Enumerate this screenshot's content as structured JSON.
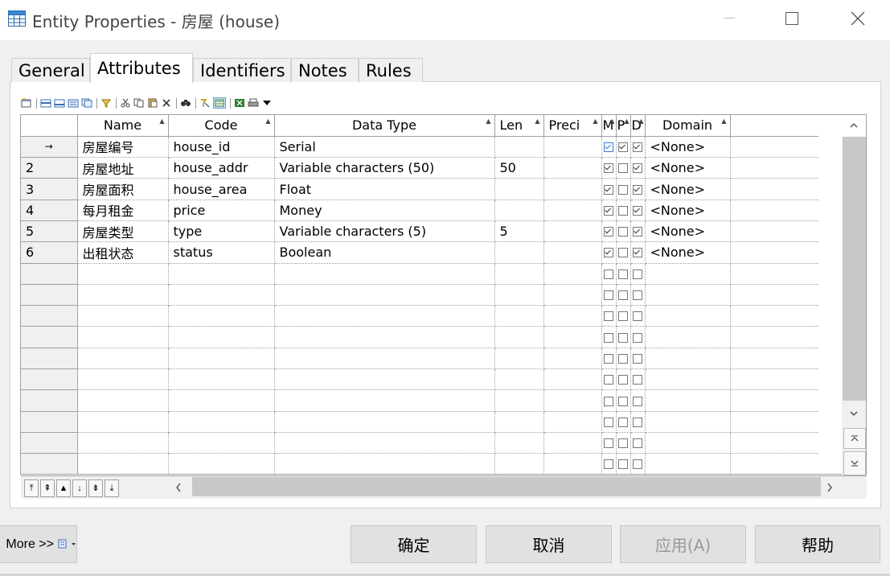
{
  "window": {
    "title": "Entity Properties - 房屋 (house)",
    "controls": {
      "minimize": "—",
      "maximize": "☐",
      "close": "✕"
    }
  },
  "tabs": [
    {
      "label": "General",
      "active": false
    },
    {
      "label": "Attributes",
      "active": true
    },
    {
      "label": "Identifiers",
      "active": false
    },
    {
      "label": "Notes",
      "active": false
    },
    {
      "label": "Rules",
      "active": false
    }
  ],
  "grid": {
    "columns": [
      "Name",
      "Code",
      "Data Type",
      "Len",
      "Preci",
      "M",
      "P",
      "D",
      "Domain"
    ],
    "current_row_marker": "→",
    "rows": [
      {
        "num": "",
        "name": "房屋编号",
        "code": "house_id",
        "type": "Serial",
        "len": "",
        "preci": "",
        "m": true,
        "p": true,
        "d": true,
        "domain": "<None>"
      },
      {
        "num": "2",
        "name": "房屋地址",
        "code": "house_addr",
        "type": "Variable characters (50)",
        "len": "50",
        "preci": "",
        "m": true,
        "p": false,
        "d": true,
        "domain": "<None>"
      },
      {
        "num": "3",
        "name": "房屋面积",
        "code": "house_area",
        "type": "Float",
        "len": "",
        "preci": "",
        "m": true,
        "p": false,
        "d": true,
        "domain": "<None>"
      },
      {
        "num": "4",
        "name": "每月租金",
        "code": "price",
        "type": "Money",
        "len": "",
        "preci": "",
        "m": true,
        "p": false,
        "d": true,
        "domain": "<None>"
      },
      {
        "num": "5",
        "name": "房屋类型",
        "code": "type",
        "type": "Variable characters (5)",
        "len": "5",
        "preci": "",
        "m": true,
        "p": false,
        "d": true,
        "domain": "<None>"
      },
      {
        "num": "6",
        "name": "出租状态",
        "code": "status",
        "type": "Boolean",
        "len": "",
        "preci": "",
        "m": true,
        "p": false,
        "d": true,
        "domain": "<None>"
      }
    ],
    "empty_rows": 10
  },
  "nav_buttons": [
    "⤒",
    "⇞",
    "▲",
    "↓",
    "⇟",
    "⤓"
  ],
  "buttons": {
    "more": "More >>",
    "ok": "确定",
    "cancel": "取消",
    "apply": "应用(A)",
    "help": "帮助"
  },
  "colors": {
    "accent": "#3a7bd5",
    "background": "#f0f0f0"
  }
}
